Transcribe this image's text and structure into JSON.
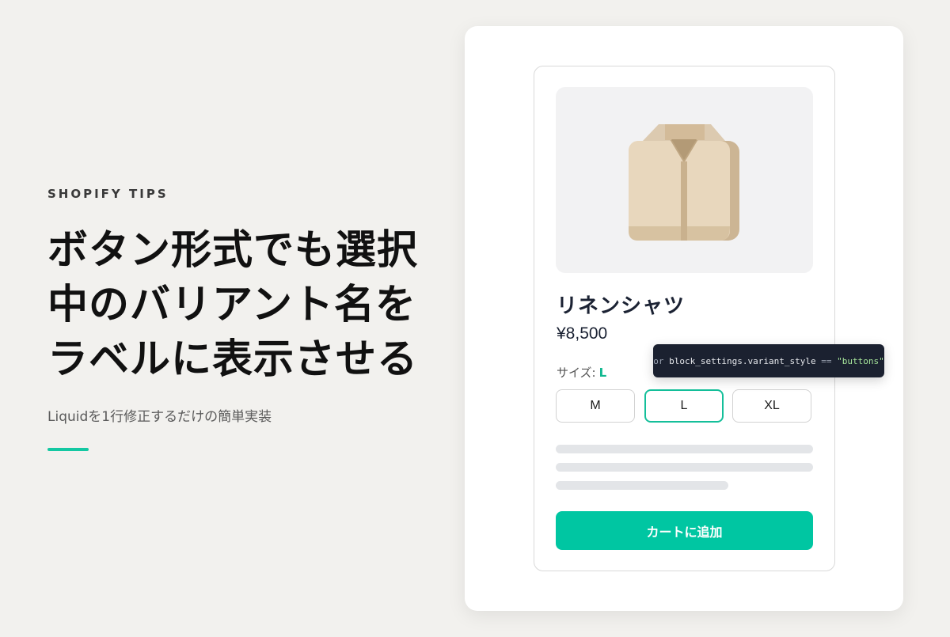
{
  "hero": {
    "eyebrow": "SHOPIFY TIPS",
    "title_lines": [
      "ボタン形式でも選択",
      "中のバリアント名を",
      "ラベルに表示させる"
    ],
    "subtitle": "Liquidを1行修正するだけの簡単実装",
    "accent_color": "#14c8a2"
  },
  "product": {
    "name": "リネンシャツ",
    "price": "¥8,500",
    "option_label": "サイズ:",
    "selected_value": "L",
    "variants": [
      "M",
      "L",
      "XL"
    ],
    "selected_index": 1,
    "add_to_cart_label": "カートに追加",
    "button_color": "#00c6a2",
    "image_icon": "folded-shirt-icon"
  },
  "code_tooltip": {
    "keyword": "or",
    "expression": "block_settings.variant_style",
    "operator": "==",
    "value": "\"buttons\""
  }
}
